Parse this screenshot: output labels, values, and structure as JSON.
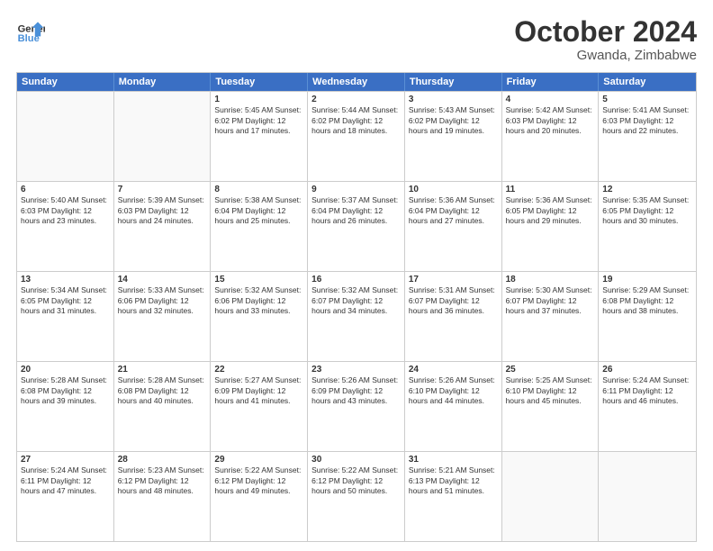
{
  "header": {
    "title": "October 2024",
    "subtitle": "Gwanda, Zimbabwe",
    "logo_general": "General",
    "logo_blue": "Blue"
  },
  "days_of_week": [
    "Sunday",
    "Monday",
    "Tuesday",
    "Wednesday",
    "Thursday",
    "Friday",
    "Saturday"
  ],
  "weeks": [
    [
      {
        "day": "",
        "data": ""
      },
      {
        "day": "",
        "data": ""
      },
      {
        "day": "1",
        "data": "Sunrise: 5:45 AM\nSunset: 6:02 PM\nDaylight: 12 hours and 17 minutes."
      },
      {
        "day": "2",
        "data": "Sunrise: 5:44 AM\nSunset: 6:02 PM\nDaylight: 12 hours and 18 minutes."
      },
      {
        "day": "3",
        "data": "Sunrise: 5:43 AM\nSunset: 6:02 PM\nDaylight: 12 hours and 19 minutes."
      },
      {
        "day": "4",
        "data": "Sunrise: 5:42 AM\nSunset: 6:03 PM\nDaylight: 12 hours and 20 minutes."
      },
      {
        "day": "5",
        "data": "Sunrise: 5:41 AM\nSunset: 6:03 PM\nDaylight: 12 hours and 22 minutes."
      }
    ],
    [
      {
        "day": "6",
        "data": "Sunrise: 5:40 AM\nSunset: 6:03 PM\nDaylight: 12 hours and 23 minutes."
      },
      {
        "day": "7",
        "data": "Sunrise: 5:39 AM\nSunset: 6:03 PM\nDaylight: 12 hours and 24 minutes."
      },
      {
        "day": "8",
        "data": "Sunrise: 5:38 AM\nSunset: 6:04 PM\nDaylight: 12 hours and 25 minutes."
      },
      {
        "day": "9",
        "data": "Sunrise: 5:37 AM\nSunset: 6:04 PM\nDaylight: 12 hours and 26 minutes."
      },
      {
        "day": "10",
        "data": "Sunrise: 5:36 AM\nSunset: 6:04 PM\nDaylight: 12 hours and 27 minutes."
      },
      {
        "day": "11",
        "data": "Sunrise: 5:36 AM\nSunset: 6:05 PM\nDaylight: 12 hours and 29 minutes."
      },
      {
        "day": "12",
        "data": "Sunrise: 5:35 AM\nSunset: 6:05 PM\nDaylight: 12 hours and 30 minutes."
      }
    ],
    [
      {
        "day": "13",
        "data": "Sunrise: 5:34 AM\nSunset: 6:05 PM\nDaylight: 12 hours and 31 minutes."
      },
      {
        "day": "14",
        "data": "Sunrise: 5:33 AM\nSunset: 6:06 PM\nDaylight: 12 hours and 32 minutes."
      },
      {
        "day": "15",
        "data": "Sunrise: 5:32 AM\nSunset: 6:06 PM\nDaylight: 12 hours and 33 minutes."
      },
      {
        "day": "16",
        "data": "Sunrise: 5:32 AM\nSunset: 6:07 PM\nDaylight: 12 hours and 34 minutes."
      },
      {
        "day": "17",
        "data": "Sunrise: 5:31 AM\nSunset: 6:07 PM\nDaylight: 12 hours and 36 minutes."
      },
      {
        "day": "18",
        "data": "Sunrise: 5:30 AM\nSunset: 6:07 PM\nDaylight: 12 hours and 37 minutes."
      },
      {
        "day": "19",
        "data": "Sunrise: 5:29 AM\nSunset: 6:08 PM\nDaylight: 12 hours and 38 minutes."
      }
    ],
    [
      {
        "day": "20",
        "data": "Sunrise: 5:28 AM\nSunset: 6:08 PM\nDaylight: 12 hours and 39 minutes."
      },
      {
        "day": "21",
        "data": "Sunrise: 5:28 AM\nSunset: 6:08 PM\nDaylight: 12 hours and 40 minutes."
      },
      {
        "day": "22",
        "data": "Sunrise: 5:27 AM\nSunset: 6:09 PM\nDaylight: 12 hours and 41 minutes."
      },
      {
        "day": "23",
        "data": "Sunrise: 5:26 AM\nSunset: 6:09 PM\nDaylight: 12 hours and 43 minutes."
      },
      {
        "day": "24",
        "data": "Sunrise: 5:26 AM\nSunset: 6:10 PM\nDaylight: 12 hours and 44 minutes."
      },
      {
        "day": "25",
        "data": "Sunrise: 5:25 AM\nSunset: 6:10 PM\nDaylight: 12 hours and 45 minutes."
      },
      {
        "day": "26",
        "data": "Sunrise: 5:24 AM\nSunset: 6:11 PM\nDaylight: 12 hours and 46 minutes."
      }
    ],
    [
      {
        "day": "27",
        "data": "Sunrise: 5:24 AM\nSunset: 6:11 PM\nDaylight: 12 hours and 47 minutes."
      },
      {
        "day": "28",
        "data": "Sunrise: 5:23 AM\nSunset: 6:12 PM\nDaylight: 12 hours and 48 minutes."
      },
      {
        "day": "29",
        "data": "Sunrise: 5:22 AM\nSunset: 6:12 PM\nDaylight: 12 hours and 49 minutes."
      },
      {
        "day": "30",
        "data": "Sunrise: 5:22 AM\nSunset: 6:12 PM\nDaylight: 12 hours and 50 minutes."
      },
      {
        "day": "31",
        "data": "Sunrise: 5:21 AM\nSunset: 6:13 PM\nDaylight: 12 hours and 51 minutes."
      },
      {
        "day": "",
        "data": ""
      },
      {
        "day": "",
        "data": ""
      }
    ]
  ]
}
